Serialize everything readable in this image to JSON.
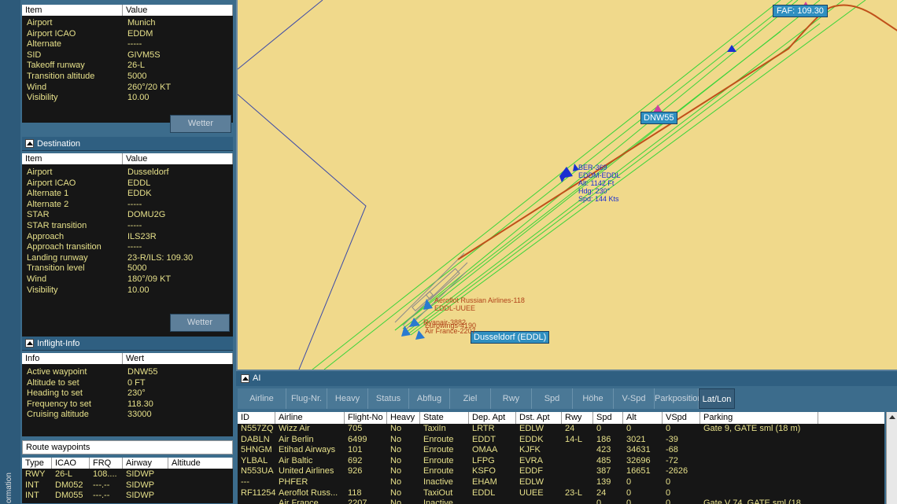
{
  "sidebar": {
    "vertical_label": "ormation",
    "departure": {
      "headers": [
        "Item",
        "Value"
      ],
      "rows": [
        {
          "item": "Airport",
          "value": "Munich"
        },
        {
          "item": "Airport ICAO",
          "value": "EDDM"
        },
        {
          "item": "Alternate",
          "value": "-----"
        },
        {
          "item": "SID",
          "value": "GIVM5S"
        },
        {
          "item": "Takeoff runway",
          "value": "26-L"
        },
        {
          "item": "Transition altitude",
          "value": "5000"
        },
        {
          "item": "Wind",
          "value": "260°/20 KT"
        },
        {
          "item": "Visibility",
          "value": "10.00"
        }
      ],
      "button_label": "Wetter"
    },
    "destination": {
      "title": "Destination",
      "headers": [
        "Item",
        "Value"
      ],
      "rows": [
        {
          "item": "Airport",
          "value": "Dusseldorf"
        },
        {
          "item": "Airport ICAO",
          "value": "EDDL"
        },
        {
          "item": "Alternate 1",
          "value": "EDDK"
        },
        {
          "item": "Alternate 2",
          "value": "-----"
        },
        {
          "item": "STAR",
          "value": "DOMU2G"
        },
        {
          "item": "STAR transition",
          "value": "-----"
        },
        {
          "item": "Approach",
          "value": "ILS23R"
        },
        {
          "item": "Approach transition",
          "value": "-----"
        },
        {
          "item": "Landing runway",
          "value": "23-R/ILS: 109.30"
        },
        {
          "item": "Transition level",
          "value": "5000"
        },
        {
          "item": "Wind",
          "value": "180°/09 KT"
        },
        {
          "item": "Visibility",
          "value": "10.00"
        }
      ],
      "button_label": "Wetter"
    },
    "inflight": {
      "title": "Inflight-Info",
      "headers": [
        "Info",
        "Wert"
      ],
      "rows": [
        {
          "item": "Active waypoint",
          "value": "DNW55"
        },
        {
          "item": "Altitude to set",
          "value": "0 FT"
        },
        {
          "item": "Heading to set",
          "value": "230°"
        },
        {
          "item": "Frequency to set",
          "value": "118.30"
        },
        {
          "item": "Cruising altitude",
          "value": "33000"
        }
      ]
    },
    "route": {
      "title": "Route waypoints",
      "headers": [
        "Type",
        "ICAO",
        "FRQ",
        "Airway",
        "Altitude"
      ],
      "rows": [
        [
          "RWY",
          "26-L",
          "108....",
          "SIDWP",
          ""
        ],
        [
          "INT",
          "DM052",
          "---.--",
          "SIDWP",
          ""
        ],
        [
          "INT",
          "DM055",
          "---.--",
          "SIDWP",
          ""
        ]
      ]
    }
  },
  "map": {
    "faf_label": "FAF: 109.30",
    "waypoint_label": "DNW55",
    "airport_label": "Dusseldorf (EDDL)",
    "aircraft_tag": {
      "callsign": "BER-369",
      "route": "EDDM-EDDL",
      "alt": "Alt: 1142 Ft",
      "hdg": "Hdg: 230°",
      "spd": "Spd: 144 Kts"
    },
    "ai_tag_1": "Aeroflot Russian Airlines-118",
    "ai_tag_2": "EDDL-UUEE",
    "ai_tag_3": "Eurowings-4190",
    "ai_tag_4": "Air France-2207",
    "ai_tag_5": "Ryanair-3882"
  },
  "ai": {
    "title": "AI",
    "tabs": [
      "Airline",
      "Flug-Nr.",
      "Heavy",
      "Status",
      "Abflug",
      "Ziel",
      "Rwy",
      "Spd",
      "Höhe",
      "V-Spd",
      "Parkposition",
      "Lat/Lon"
    ],
    "active_tab": "Lat/Lon",
    "headers": [
      "ID",
      "Airline",
      "Flight-No",
      "Heavy",
      "State",
      "Dep. Apt",
      "Dst. Apt",
      "Rwy",
      "Spd",
      "Alt",
      "VSpd",
      "Parking"
    ],
    "rows": [
      [
        "N557ZQ",
        "Wizz Air",
        "705",
        "No",
        "TaxiIn",
        "LRTR",
        "EDLW",
        "24",
        "0",
        "0",
        "0",
        "Gate 9, GATE sml (18 m)"
      ],
      [
        "DABLN",
        "Air Berlin",
        "6499",
        "No",
        "Enroute",
        "EDDT",
        "EDDK",
        "14-L",
        "186",
        "3021",
        "-39",
        ""
      ],
      [
        "5HNGM",
        "Etihad Airways",
        "101",
        "No",
        "Enroute",
        "OMAA",
        "KJFK",
        "",
        "423",
        "34631",
        "-68",
        ""
      ],
      [
        "YLBAL",
        "Air Baltic",
        "692",
        "No",
        "Enroute",
        "LFPG",
        "EVRA",
        "",
        "485",
        "32696",
        "-72",
        ""
      ],
      [
        "N553UA",
        "United Airlines",
        "926",
        "No",
        "Enroute",
        "KSFO",
        "EDDF",
        "",
        "387",
        "16651",
        "-2626",
        ""
      ],
      [
        "---",
        "PHFER",
        "",
        "No",
        "Inactive",
        "EHAM",
        "EDLW",
        "",
        "139",
        "0",
        "0",
        ""
      ],
      [
        "RF11254",
        "Aeroflot Russ...",
        "118",
        "No",
        "TaxiOut",
        "EDDL",
        "UUEE",
        "23-L",
        "24",
        "0",
        "0",
        ""
      ],
      [
        "",
        "Air France",
        "2207",
        "No",
        "Inactive",
        "",
        "",
        "",
        "0",
        "0",
        "0",
        "Gate V 74, GATE sml (18 ..."
      ]
    ]
  },
  "colors": {
    "map_bg": "#f0d98b",
    "route": "#c0501a",
    "ils_cone": "#3ad43a",
    "boundary": "#3b4aa8",
    "label_bg": "#2f8fc0",
    "grid_text": "#e6e08a"
  }
}
